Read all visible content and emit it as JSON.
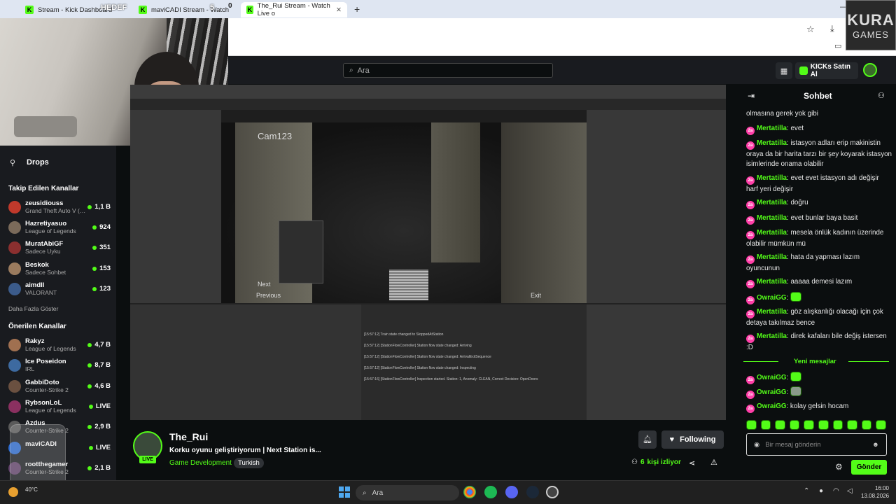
{
  "browser": {
    "tabs": [
      {
        "label": "Stream - Kick Dashboard",
        "counter": "0"
      },
      {
        "label": "maviCADI Stream - Watch",
        "prefix": "HEDEF",
        "counter": "5"
      },
      {
        "label": "The_Rui Stream - Watch Live o",
        "active": true
      }
    ],
    "new_tab": "+"
  },
  "watermark": {
    "line1": "KURA",
    "line2": "GAMES"
  },
  "topnav": {
    "search_placeholder": "Ara",
    "kicks_label": "KICKs Satın Al"
  },
  "sidebar": {
    "drops_label": "Drops",
    "followed_header": "Takip Edilen Kanallar",
    "followed": [
      {
        "name": "zeusidiouss",
        "sub": "Grand Theft Auto V (…",
        "count": "1,1 B",
        "color": "#c0392b"
      },
      {
        "name": "Hazretiyasuo",
        "sub": "League of Legends",
        "count": "924",
        "color": "#7a6a5a"
      },
      {
        "name": "MuratAbiGF",
        "sub": "Sadece Uyku",
        "count": "351",
        "color": "#8b2f2f"
      },
      {
        "name": "Beskok",
        "sub": "Sadece Sohbet",
        "count": "153",
        "color": "#9a7b5e"
      },
      {
        "name": "aimdll",
        "sub": "VALORANT",
        "count": "123",
        "color": "#3b5b8a"
      }
    ],
    "show_more": "Daha Fazla Göster",
    "recommended_header": "Önerilen Kanallar",
    "recommended": [
      {
        "name": "Rakyz",
        "sub": "League of Legends",
        "count": "4,7 B",
        "color": "#a07050"
      },
      {
        "name": "Ice Poseidon",
        "sub": "IRL",
        "count": "8,7 B",
        "color": "#3d6aa0"
      },
      {
        "name": "GabbiDoto",
        "sub": "Counter-Strike 2",
        "count": "4,6 B",
        "color": "#6a5040"
      },
      {
        "name": "RybsonLoL",
        "sub": "League of Legends",
        "count": "LIVE",
        "color": "#8a3060"
      },
      {
        "name": "Azdus",
        "sub": "Counter-Strike 2",
        "count": "2,9 B",
        "color": "#5a5a5a"
      },
      {
        "name": "maviCADI",
        "sub": "",
        "count": "LIVE",
        "color": "#2a6ad0"
      },
      {
        "name": "rootthegamer",
        "sub": "Counter-Strike 2",
        "count": "2,1 B",
        "color": "#60406a"
      }
    ]
  },
  "video": {
    "cam_label": "Cam123",
    "next_label": "Next",
    "previous_label": "Previous",
    "exit_label": "Exit",
    "console_lines": [
      "[15:57:12] Train state changed to StoppedAtStation",
      "[15:57:12] [StationFlowController] Station flow state changed: Arriving",
      "[15:57:12] [StationFlowController] Station flow state changed: ArrivalExitSequence",
      "[15:57:12] [StationFlowController] Station flow state changed: Inspecting",
      "[15:57:16] [StationFlowController] Inspection started. Station: 1, Anomaly: CLEAN, Correct Decision: OpenDoors"
    ]
  },
  "stream": {
    "channel": "The_Rui",
    "title": "Korku oyunu geliştiriyorum | Next Station is...",
    "category": "Game Development",
    "tag": "Turkish",
    "live_badge": "LIVE",
    "following_label": "Following",
    "viewers_count": "6",
    "viewers_label": "kişi izliyor"
  },
  "chat": {
    "title": "Sohbet",
    "messages": [
      {
        "user": "",
        "text": "olmasına gerek yok gibi"
      },
      {
        "user": "Mertatilla",
        "text": "evet"
      },
      {
        "user": "Mertatilla",
        "text": "istasyon adları erip makinistin oraya da bir harita tarzı bir şey koyarak istasyon isimlerinde onama olabilir"
      },
      {
        "user": "Mertatilla",
        "text": "evet evet istasyon adı değişir harf yeri değişir"
      },
      {
        "user": "Mertatilla",
        "text": "doğru"
      },
      {
        "user": "Mertatilla",
        "text": "evet bunlar baya basit"
      },
      {
        "user": "Mertatilla",
        "text": "mesela önlük kadının üzerinde olabilir mümkün mü"
      },
      {
        "user": "Mertatilla",
        "text": "hata da yapması lazım oyuncunun"
      },
      {
        "user": "Mertatilla",
        "text": "aaaaa demesi lazım"
      },
      {
        "user": "OwraiGG",
        "text": "",
        "emote": true
      },
      {
        "user": "Mertatilla",
        "text": "göz alışkanlığı olacağı için çok detaya takılmaz bence"
      },
      {
        "user": "Mertatilla",
        "text": "direk kafaları bile değiş istersen :D"
      }
    ],
    "new_messages_label": "Yeni mesajlar",
    "new_messages": [
      {
        "user": "OwraiGG",
        "text": "",
        "emote": true
      },
      {
        "user": "OwraiGG",
        "text": "",
        "emote": true
      },
      {
        "user": "OwraiGG",
        "text": "kolay gelsin hocam"
      }
    ],
    "input_placeholder": "Bir mesaj gönderin",
    "send_label": "Gönder"
  },
  "taskbar": {
    "search_label": "Ara",
    "time": "16:00",
    "date": "13.08.2026",
    "weather": "40°C"
  }
}
